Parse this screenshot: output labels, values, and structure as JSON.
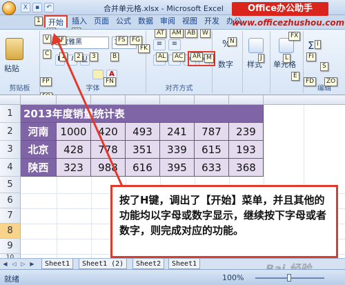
{
  "window": {
    "title": "合并单元格.xlsx - Microsoft Excel",
    "brand": "Office办公助手",
    "brand_url": "www.officezhushou.com"
  },
  "tabs": [
    {
      "label": "开始",
      "active": true
    },
    {
      "label": "插入"
    },
    {
      "label": "页面"
    },
    {
      "label": "公式"
    },
    {
      "label": "数据"
    },
    {
      "label": "审阅"
    },
    {
      "label": "视图"
    },
    {
      "label": "开发"
    },
    {
      "label": "办公"
    }
  ],
  "keytips": {
    "tab_home": "H",
    "tab_insert": "N",
    "qat": "1",
    "row1": [
      "V",
      "FF",
      "FS",
      "FG",
      "FK",
      "AT",
      "AM",
      "AB",
      "W",
      "N",
      "FX",
      "I"
    ],
    "row2": [
      "C",
      "1",
      "2",
      "3",
      "B",
      "AL",
      "AC",
      "AR",
      "M",
      "J",
      "L",
      "FI",
      "S"
    ],
    "row3": [
      "FP",
      "FO",
      "FN",
      "FA",
      "ZS",
      "ZC",
      "E",
      "FD",
      "ZO"
    ],
    "clark": "ZC",
    "ribbon_right": "ZR"
  },
  "ribbon": {
    "paste_label": "粘贴",
    "clipboard_label": "剪贴板",
    "font_name": "微软雅黑",
    "font_size": "11",
    "font_label": "字体",
    "align_label": "对齐方式",
    "number_label": "数字",
    "style_label": "样式",
    "cells_label": "单元格",
    "edit_label": "编辑",
    "percent": "%"
  },
  "sheet": {
    "columns": [
      "",
      "",
      "",
      "",
      "",
      "",
      ""
    ],
    "rows": [
      "1",
      "2",
      "3",
      "4",
      "5",
      "6",
      "7",
      "8",
      "9",
      "10"
    ],
    "table_title": "2013年度销量统计表",
    "data": [
      {
        "region": "河南",
        "values": [
          "1000",
          "420",
          "493",
          "241",
          "787",
          "239"
        ]
      },
      {
        "region": "北京",
        "values": [
          "428",
          "778",
          "351",
          "339",
          "615",
          "193"
        ]
      },
      {
        "region": "陕西",
        "values": [
          "323",
          "988",
          "616",
          "395",
          "633",
          "368"
        ]
      }
    ]
  },
  "callout": {
    "text": "按了H键，调出了【开始】菜单，并且其他的功能均以字母或数字显示，继续按下字母或者数字，则完成对应的功能。"
  },
  "sheet_tabs": [
    "Sheet1",
    "Sheet1 (2)",
    "Sheet2",
    "Sheet1"
  ],
  "status": {
    "ready": "就绪",
    "zoom": "100%"
  },
  "watermark": "Bai 经验",
  "colors": {
    "accent_red": "#e23a2a",
    "table_header_purple": "#8065a6",
    "table_cell_lavender": "#e4dcee"
  }
}
